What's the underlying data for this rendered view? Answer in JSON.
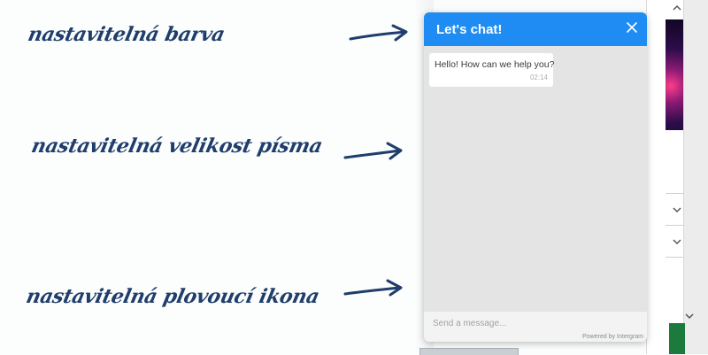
{
  "annotations": {
    "color": "nastavitelná  barva",
    "font_size": "nastavitelná velikost písma",
    "icon": "nastavitelná plovoucí ikona"
  },
  "chat": {
    "title": "Let's chat!",
    "header_color": "#1e8cf2",
    "close_icon": "close-icon",
    "messages": [
      {
        "text": "Hello! How can we help you?",
        "time": "02:14"
      }
    ],
    "input_placeholder": "Send a message...",
    "powered_by": "Powered by Intergram"
  },
  "background_page": {
    "chevron_icon": "chevron-down-icon"
  }
}
